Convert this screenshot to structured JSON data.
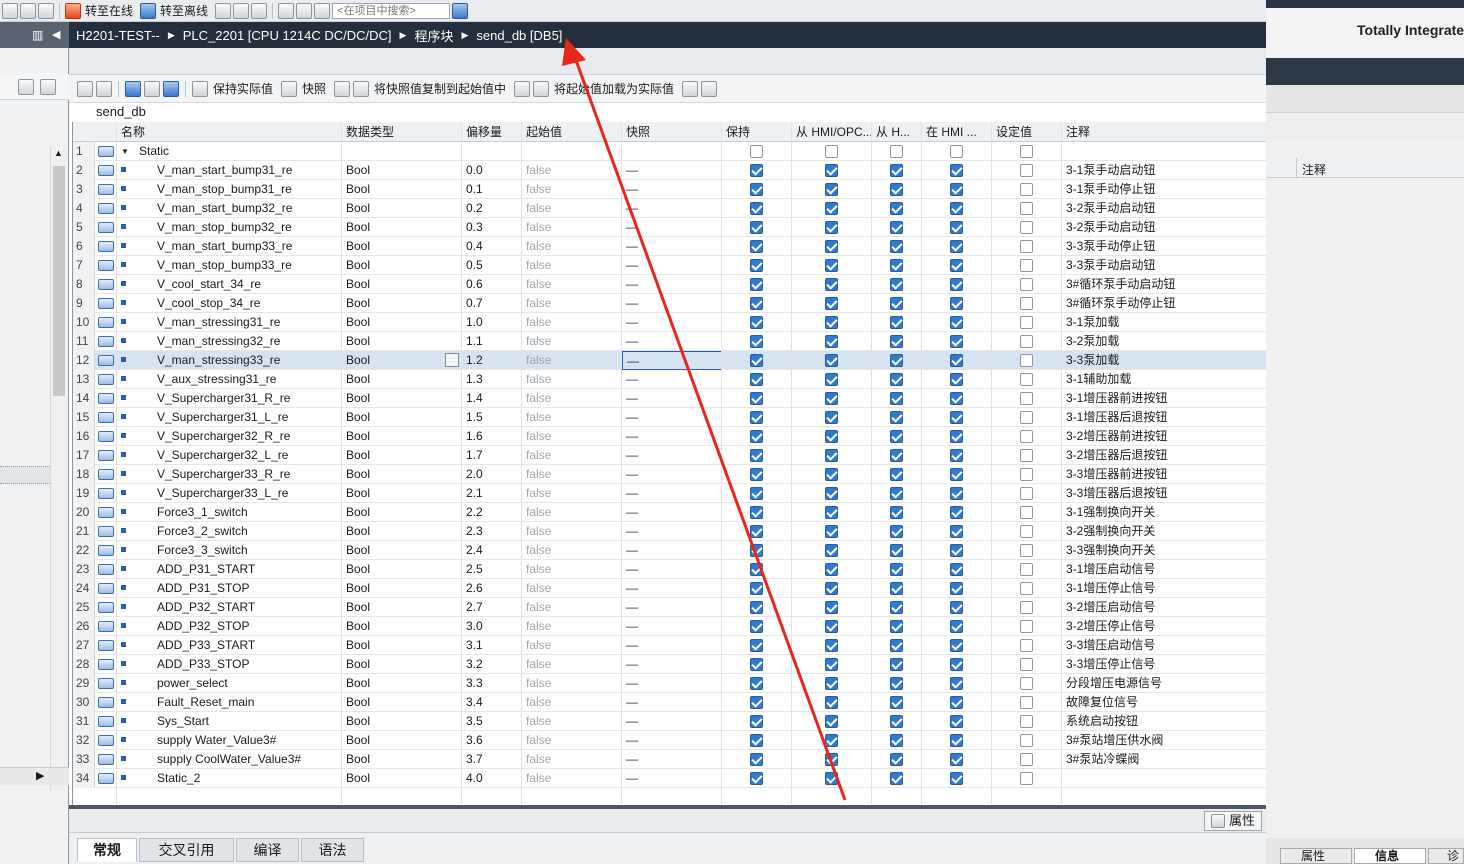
{
  "toolbar": {
    "go_online": "转至在线",
    "go_offline": "转至离线",
    "search_placeholder": "<在项目中搜索>"
  },
  "breadcrumb": [
    "H2201-TEST--",
    "PLC_2201 [CPU 1214C DC/DC/DC]",
    "程序块",
    "send_db [DB5]"
  ],
  "block_toolbar": {
    "keep_actual": "保持实际值",
    "snapshot": "快照",
    "copy_snapshot": "将快照值复制到起始值中",
    "load_start": "将起始值加载为实际值"
  },
  "db_title": "send_db",
  "columns": [
    "名称",
    "数据类型",
    "偏移量",
    "起始值",
    "快照",
    "保持",
    "从 HMI/OPC...",
    "从 H...",
    "在 HMI ...",
    "设定值",
    "注释"
  ],
  "rows": [
    {
      "n": "1",
      "name": "Static",
      "type": "",
      "off": "",
      "start": "",
      "snap": "",
      "top": true
    },
    {
      "n": "2",
      "name": "V_man_start_bump31_re",
      "type": "Bool",
      "off": "0.0",
      "start": "false",
      "snap": "—",
      "cmt": "3-1泵手动启动钮"
    },
    {
      "n": "3",
      "name": "V_man_stop_bump31_re",
      "type": "Bool",
      "off": "0.1",
      "start": "false",
      "snap": "—",
      "cmt": "3-1泵手动停止钮"
    },
    {
      "n": "4",
      "name": "V_man_start_bump32_re",
      "type": "Bool",
      "off": "0.2",
      "start": "false",
      "snap": "—",
      "cmt": "3-2泵手动启动钮"
    },
    {
      "n": "5",
      "name": "V_man_stop_bump32_re",
      "type": "Bool",
      "off": "0.3",
      "start": "false",
      "snap": "—",
      "cmt": "3-2泵手动启动钮"
    },
    {
      "n": "6",
      "name": "V_man_start_bump33_re",
      "type": "Bool",
      "off": "0.4",
      "start": "false",
      "snap": "—",
      "cmt": "3-3泵手动停止钮"
    },
    {
      "n": "7",
      "name": "V_man_stop_bump33_re",
      "type": "Bool",
      "off": "0.5",
      "start": "false",
      "snap": "—",
      "cmt": "3-3泵手动启动钮"
    },
    {
      "n": "8",
      "name": "V_cool_start_34_re",
      "type": "Bool",
      "off": "0.6",
      "start": "false",
      "snap": "—",
      "cmt": "3#循环泵手动启动钮"
    },
    {
      "n": "9",
      "name": "V_cool_stop_34_re",
      "type": "Bool",
      "off": "0.7",
      "start": "false",
      "snap": "—",
      "cmt": "3#循环泵手动停止钮"
    },
    {
      "n": "10",
      "name": "V_man_stressing31_re",
      "type": "Bool",
      "off": "1.0",
      "start": "false",
      "snap": "—",
      "cmt": "3-1泵加载"
    },
    {
      "n": "11",
      "name": "V_man_stressing32_re",
      "type": "Bool",
      "off": "1.1",
      "start": "false",
      "snap": "—",
      "cmt": "3-2泵加载"
    },
    {
      "n": "12",
      "name": "V_man_stressing33_re",
      "type": "Bool",
      "off": "1.2",
      "start": "false",
      "snap": "—",
      "cmt": "3-3泵加载",
      "sel": true
    },
    {
      "n": "13",
      "name": "V_aux_stressing31_re",
      "type": "Bool",
      "off": "1.3",
      "start": "false",
      "snap": "—",
      "cmt": "3-1辅助加载"
    },
    {
      "n": "14",
      "name": "V_Supercharger31_R_re",
      "type": "Bool",
      "off": "1.4",
      "start": "false",
      "snap": "—",
      "cmt": "3-1增压器前进按钮"
    },
    {
      "n": "15",
      "name": "V_Supercharger31_L_re",
      "type": "Bool",
      "off": "1.5",
      "start": "false",
      "snap": "—",
      "cmt": "3-1增压器后退按钮"
    },
    {
      "n": "16",
      "name": "V_Supercharger32_R_re",
      "type": "Bool",
      "off": "1.6",
      "start": "false",
      "snap": "—",
      "cmt": "3-2增压器前进按钮"
    },
    {
      "n": "17",
      "name": "V_Supercharger32_L_re",
      "type": "Bool",
      "off": "1.7",
      "start": "false",
      "snap": "—",
      "cmt": "3-2增压器后退按钮"
    },
    {
      "n": "18",
      "name": "V_Supercharger33_R_re",
      "type": "Bool",
      "off": "2.0",
      "start": "false",
      "snap": "—",
      "cmt": "3-3增压器前进按钮"
    },
    {
      "n": "19",
      "name": "V_Supercharger33_L_re",
      "type": "Bool",
      "off": "2.1",
      "start": "false",
      "snap": "—",
      "cmt": "3-3增压器后退按钮"
    },
    {
      "n": "20",
      "name": "Force3_1_switch",
      "type": "Bool",
      "off": "2.2",
      "start": "false",
      "snap": "—",
      "cmt": "3-1强制换向开关"
    },
    {
      "n": "21",
      "name": "Force3_2_switch",
      "type": "Bool",
      "off": "2.3",
      "start": "false",
      "snap": "—",
      "cmt": "3-2强制换向开关"
    },
    {
      "n": "22",
      "name": "Force3_3_switch",
      "type": "Bool",
      "off": "2.4",
      "start": "false",
      "snap": "—",
      "cmt": "3-3强制换向开关"
    },
    {
      "n": "23",
      "name": "ADD_P31_START",
      "type": "Bool",
      "off": "2.5",
      "start": "false",
      "snap": "—",
      "cmt": "3-1增压启动信号"
    },
    {
      "n": "24",
      "name": "ADD_P31_STOP",
      "type": "Bool",
      "off": "2.6",
      "start": "false",
      "snap": "—",
      "cmt": "3-1增压停止信号"
    },
    {
      "n": "25",
      "name": "ADD_P32_START",
      "type": "Bool",
      "off": "2.7",
      "start": "false",
      "snap": "—",
      "cmt": "3-2增压启动信号"
    },
    {
      "n": "26",
      "name": "ADD_P32_STOP",
      "type": "Bool",
      "off": "3.0",
      "start": "false",
      "snap": "—",
      "cmt": "3-2增压停止信号"
    },
    {
      "n": "27",
      "name": "ADD_P33_START",
      "type": "Bool",
      "off": "3.1",
      "start": "false",
      "snap": "—",
      "cmt": "3-3增压启动信号"
    },
    {
      "n": "28",
      "name": "ADD_P33_STOP",
      "type": "Bool",
      "off": "3.2",
      "start": "false",
      "snap": "—",
      "cmt": "3-3增压停止信号"
    },
    {
      "n": "29",
      "name": "power_select",
      "type": "Bool",
      "off": "3.3",
      "start": "false",
      "snap": "—",
      "cmt": "分段增压电源信号"
    },
    {
      "n": "30",
      "name": "Fault_Reset_main",
      "type": "Bool",
      "off": "3.4",
      "start": "false",
      "snap": "—",
      "cmt": "故障复位信号"
    },
    {
      "n": "31",
      "name": "Sys_Start",
      "type": "Bool",
      "off": "3.5",
      "start": "false",
      "snap": "—",
      "cmt": "系统启动按钮"
    },
    {
      "n": "32",
      "name": "supply Water_Value3#",
      "type": "Bool",
      "off": "3.6",
      "start": "false",
      "snap": "—",
      "cmt": "3#泵站增压供水阀"
    },
    {
      "n": "33",
      "name": "supply CoolWater_Value3#",
      "type": "Bool",
      "off": "3.7",
      "start": "false",
      "snap": "—",
      "cmt": "3#泵站冷蝶阀"
    },
    {
      "n": "34",
      "name": "Static_2",
      "type": "Bool",
      "off": "4.0",
      "start": "false",
      "snap": "—",
      "cmt": ""
    }
  ],
  "properties_label": "属性",
  "bottom_tabs": [
    "常规",
    "交叉引用",
    "编译",
    "语法"
  ],
  "right_panel": {
    "title": "Totally Integrate",
    "comment_header": "注释",
    "bottom_tabs": [
      "属性",
      "信息",
      "诊"
    ]
  }
}
